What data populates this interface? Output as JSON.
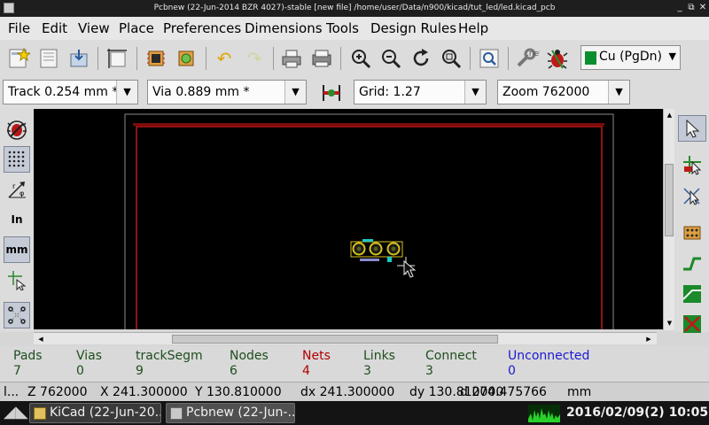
{
  "window": {
    "title": "Pcbnew (22-Jun-2014 BZR 4027)-stable  [new file] /home/user/Data/n900/kicad/tut_led/led.kicad_pcb",
    "minimize": "_",
    "maximize": "⧉",
    "close": "✕"
  },
  "menu": [
    "File",
    "Edit",
    "View",
    "Place",
    "Preferences",
    "Dimensions",
    "Tools",
    "Design Rules",
    "Help"
  ],
  "toolbar": {
    "layer": "Cu (PgDn)",
    "layer_color": "#0a8f2e",
    "netlist_label": ".net"
  },
  "selects": {
    "track": "Track 0.254 mm *",
    "via": "Via 0.889 mm *",
    "grid": "Grid: 1.27",
    "zoom": "Zoom 762000"
  },
  "left_tools": {
    "inch_label": "In",
    "mm_label": "mm"
  },
  "msg_panel": [
    {
      "label": "Pads",
      "value": "7",
      "color": "#1e4e1e"
    },
    {
      "label": "Vias",
      "value": "0",
      "color": "#1e4e1e"
    },
    {
      "label": "trackSegm",
      "value": "9",
      "color": "#1e4e1e"
    },
    {
      "label": "Nodes",
      "value": "6",
      "color": "#1e4e1e"
    },
    {
      "label": "Nets",
      "value": "4",
      "color": "#b00000"
    },
    {
      "label": "Links",
      "value": "3",
      "color": "#1e4e1e"
    },
    {
      "label": "Connect",
      "value": "3",
      "color": "#1e4e1e"
    },
    {
      "label": "Unconnected",
      "value": "0",
      "color": "#1a1ad0"
    }
  ],
  "status": {
    "s0": "l...",
    "zoom": "Z 762000",
    "x": "X 241.300000",
    "y": "Y 130.810000",
    "dx": "dx 241.300000",
    "dy": "dy 130.810000",
    "d": "d 274.475766",
    "units": "mm"
  },
  "taskbar": {
    "tasks": [
      {
        "label": "KiCad (22-Jun-20..."
      },
      {
        "label": "Pcbnew (22-Jun-..."
      }
    ],
    "clock": "2016/02/09(2) 10:05PM"
  }
}
